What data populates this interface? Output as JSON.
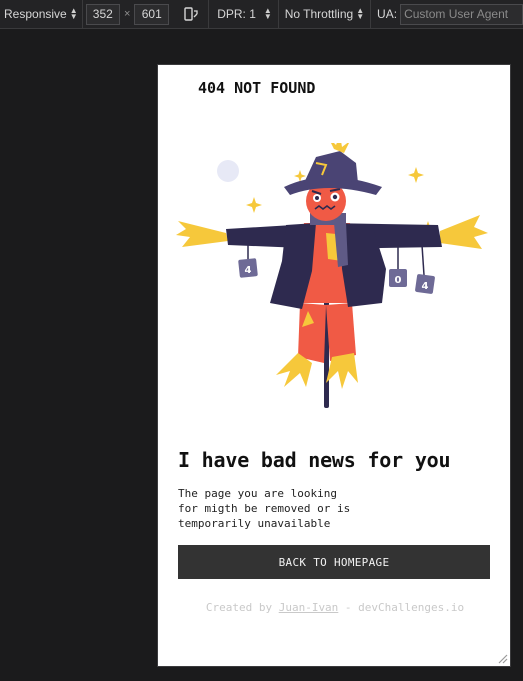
{
  "toolbar": {
    "device": "Responsive",
    "width": "352",
    "times": "×",
    "height": "601",
    "dpr": "DPR: 1",
    "throttling": "No Throttling",
    "ua_label": "UA:",
    "ua_placeholder": "Custom User Agent",
    "icons": [
      "select-arrows-icon",
      "rotate-device-icon"
    ]
  },
  "page": {
    "title": "404 NOT FOUND",
    "headline": "I have bad news for you",
    "description": "The page you are looking\nfor migth be removed or is\ntemporarily unavailable",
    "button_label": "BACK TO HOMEPAGE",
    "footer_prefix": "Created by ",
    "footer_author": "Juan-Ivan",
    "footer_suffix": " - devChallenges.io",
    "illustration": {
      "name": "scarecrow-illustration",
      "sign_letters": [
        "4",
        "0",
        "4"
      ]
    }
  },
  "colors": {
    "page_bg": "#ffffff",
    "button_bg": "#333333",
    "coat": "#2e2a4f",
    "body_orange": "#f05a45",
    "straw": "#f6c83b",
    "hat": "#4a4474"
  }
}
